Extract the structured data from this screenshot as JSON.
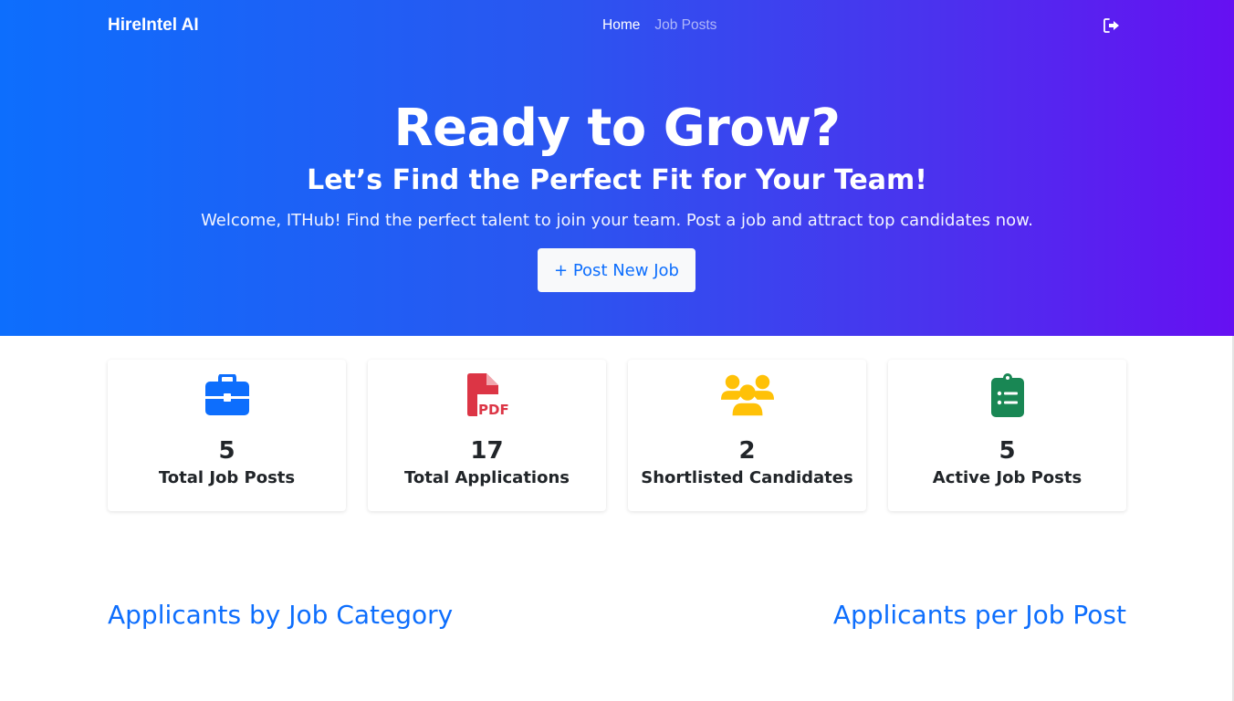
{
  "nav": {
    "brand": "HireIntel AI",
    "links": [
      {
        "label": "Home",
        "active": true
      },
      {
        "label": "Job Posts",
        "active": false
      }
    ],
    "logout_icon": "sign-out-icon"
  },
  "hero": {
    "title": "Ready to Grow?",
    "subtitle": "Let’s Find the Perfect Fit for Your Team!",
    "welcome": "Welcome, ITHub! Find the perfect talent to join your team. Post a job and attract top candidates now.",
    "button_label": "+ Post New Job"
  },
  "stats": [
    {
      "icon": "briefcase-icon",
      "color": "#0d6efd",
      "value": "5",
      "label": "Total Job Posts"
    },
    {
      "icon": "pdf-file-icon",
      "color": "#dc3545",
      "value": "17",
      "label": "Total Applications"
    },
    {
      "icon": "users-icon",
      "color": "#ffc107",
      "value": "2",
      "label": "Shortlisted Candidates"
    },
    {
      "icon": "clipboard-list-icon",
      "color": "#198754",
      "value": "5",
      "label": "Active Job Posts"
    }
  ],
  "sections": {
    "left_title": "Applicants by Job Category",
    "right_title": "Applicants per Job Post"
  },
  "colors": {
    "primary": "#0d6efd",
    "gradient_end": "#6610f2"
  }
}
